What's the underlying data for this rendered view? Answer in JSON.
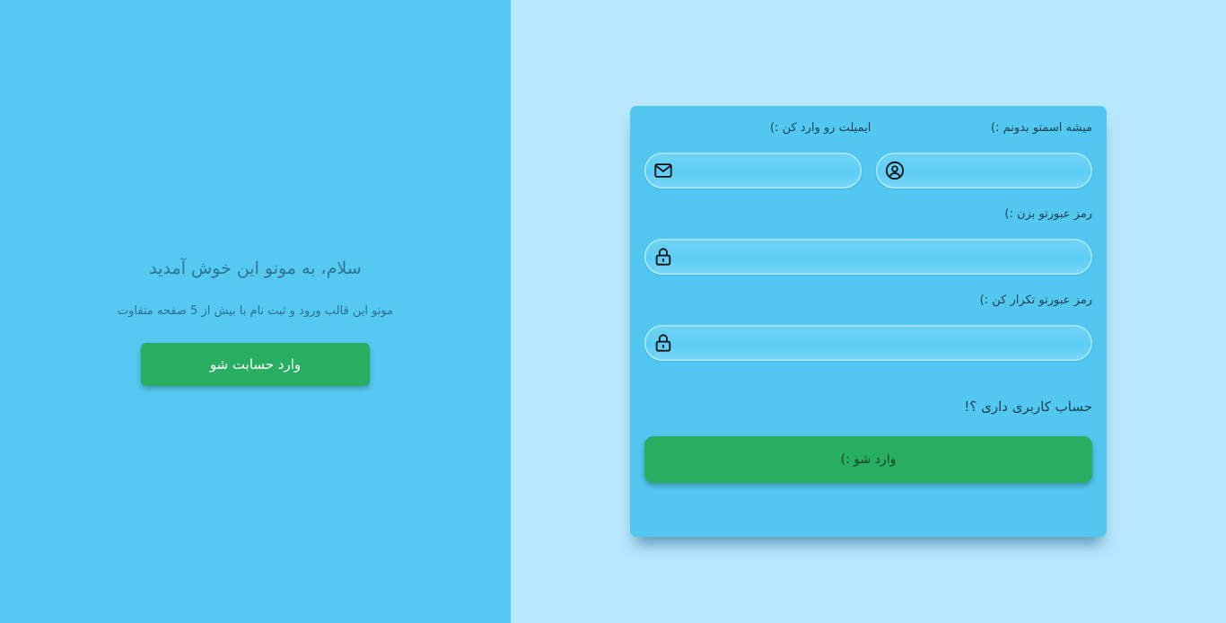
{
  "welcome": {
    "title": "سلام، به مونو این خوش آمدید",
    "subtitle": "مونو این قالب ورود و ثبت نام با بیش از 5 صفحه متفاوت",
    "login_button": "وارد حسابت شو"
  },
  "form": {
    "name_label": "میشه اسمتو بدونم :)",
    "email_label": "ایمیلت رو وارد کن :)",
    "password_label": "رمز عبورتو بزن :)",
    "confirm_password_label": "رمز عبورتو تکرار کن :)",
    "name_value": "",
    "email_value": "",
    "password_value": "",
    "confirm_password_value": "",
    "have_account_text": "حساب کاربری داری ؟!",
    "submit_button": "وارد شو :)"
  },
  "icons": {
    "name_icon": "user-circle-icon",
    "email_icon": "envelope-icon",
    "password_icon": "lock-icon",
    "confirm_password_icon": "lock-icon"
  },
  "colors": {
    "left_panel_bg": "#56c9f2",
    "page_bg": "#b9e7fd",
    "card_bg": "#52c8f1",
    "accent_green": "#27ae60"
  }
}
